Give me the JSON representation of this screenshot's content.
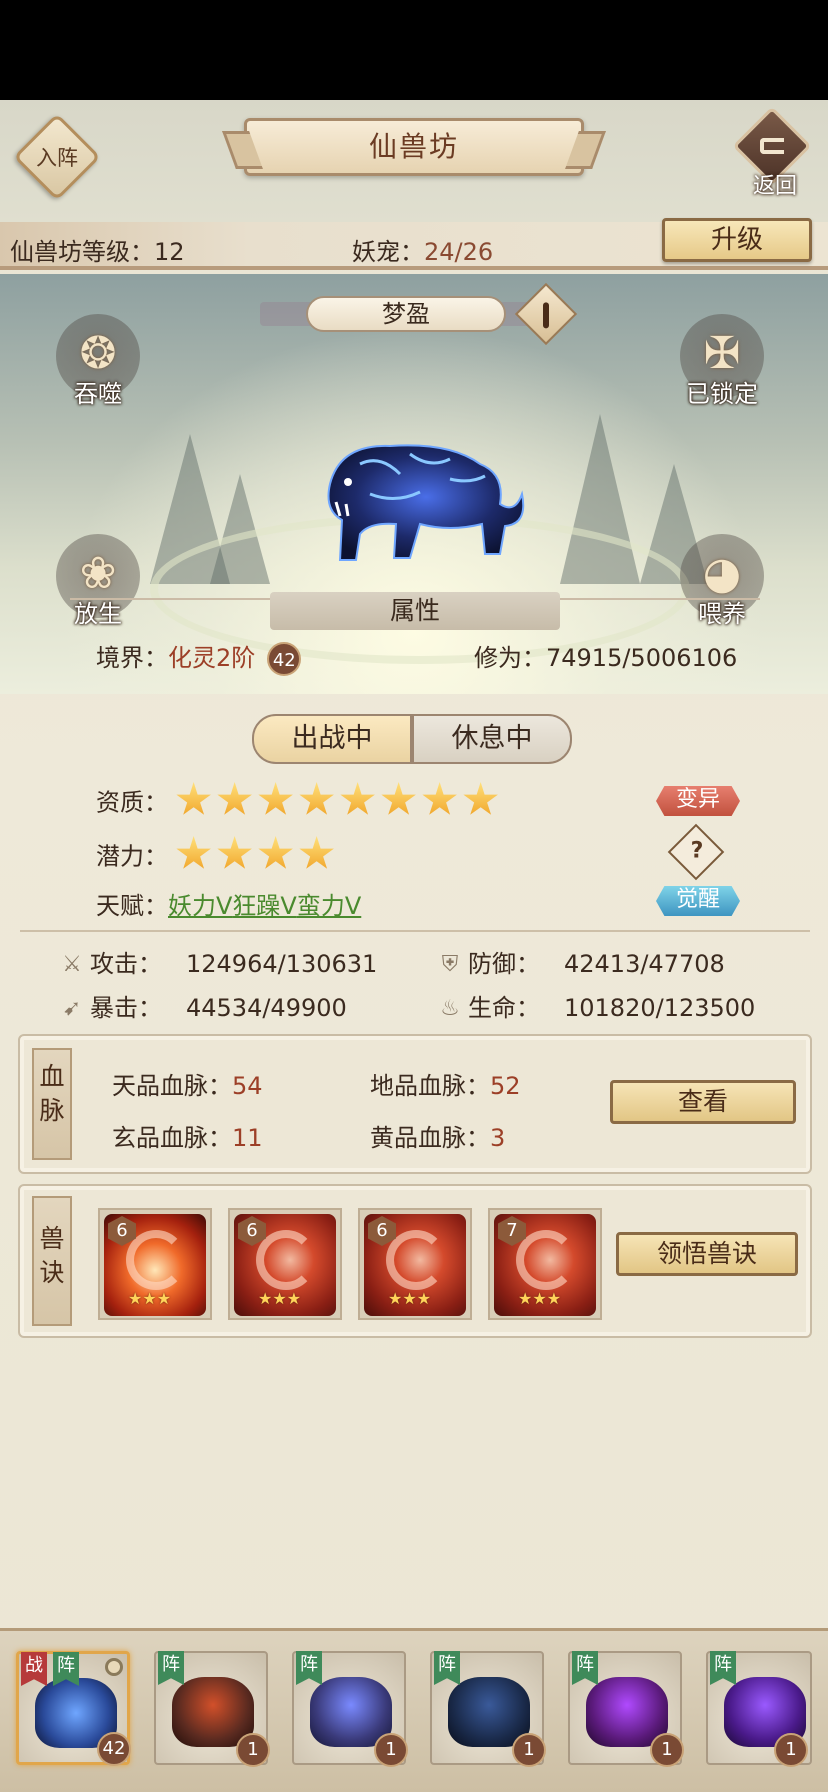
{
  "header": {
    "enter_label": "入阵",
    "title": "仙兽坊",
    "back_label": "返回",
    "level_label": "仙兽坊等级：",
    "level_value": "12",
    "pets_label": "妖宠：",
    "pets_value": "24/26",
    "upgrade_label": "升级"
  },
  "scene": {
    "pet_name": "梦盈",
    "actions": {
      "devour": "吞噬",
      "release": "放生",
      "locked": "已锁定",
      "feed": "喂养"
    },
    "toggle": {
      "active": "出战中",
      "rest": "休息中"
    }
  },
  "attributes": {
    "heading": "属性",
    "realm_label": "境界：",
    "realm_value": "化灵2阶",
    "realm_badge": "42",
    "cultivation_label": "修为：",
    "cultivation_value": "74915/5006106",
    "aptitude_label": "资质：",
    "aptitude_stars": 8,
    "potential_label": "潜力：",
    "potential_stars": 4,
    "talent_label": "天赋：",
    "talents": [
      "妖力V",
      "狂躁V",
      "蛮力V"
    ],
    "mutate_tag": "变异",
    "help_glyph": "?",
    "awaken_tag": "觉醒"
  },
  "stats": {
    "attack_label": "攻击：",
    "attack_value": "124964/130631",
    "defense_label": "防御：",
    "defense_value": "42413/47708",
    "crit_label": "暴击：",
    "crit_value": "44534/49900",
    "life_label": "生命：",
    "life_value": "101820/123500"
  },
  "bloodline": {
    "title": "血脉",
    "sky_label": "天品血脉：",
    "sky_value": "54",
    "earth_label": "地品血脉：",
    "earth_value": "52",
    "mystic_label": "玄品血脉：",
    "mystic_value": "11",
    "yellow_label": "黄品血脉：",
    "yellow_value": "3",
    "view_label": "查看"
  },
  "skills": {
    "title": "兽诀",
    "items": [
      {
        "level": "6",
        "stars": "★★★"
      },
      {
        "level": "6",
        "stars": "★★★"
      },
      {
        "level": "6",
        "stars": "★★★"
      },
      {
        "level": "7",
        "stars": "★★★"
      }
    ],
    "learn_label": "领悟兽诀"
  },
  "pet_bar": {
    "battle_flag": "战",
    "formation_flag": "阵",
    "pets": [
      {
        "level": "42",
        "color": "#2a4a9a"
      },
      {
        "level": "1",
        "color": "#5a2a20"
      },
      {
        "level": "1",
        "color": "#3a3a7a"
      },
      {
        "level": "1",
        "color": "#1a2a4a"
      },
      {
        "level": "1",
        "color": "#5a1a7a"
      },
      {
        "level": "1",
        "color": "#4a1a8a"
      }
    ]
  }
}
